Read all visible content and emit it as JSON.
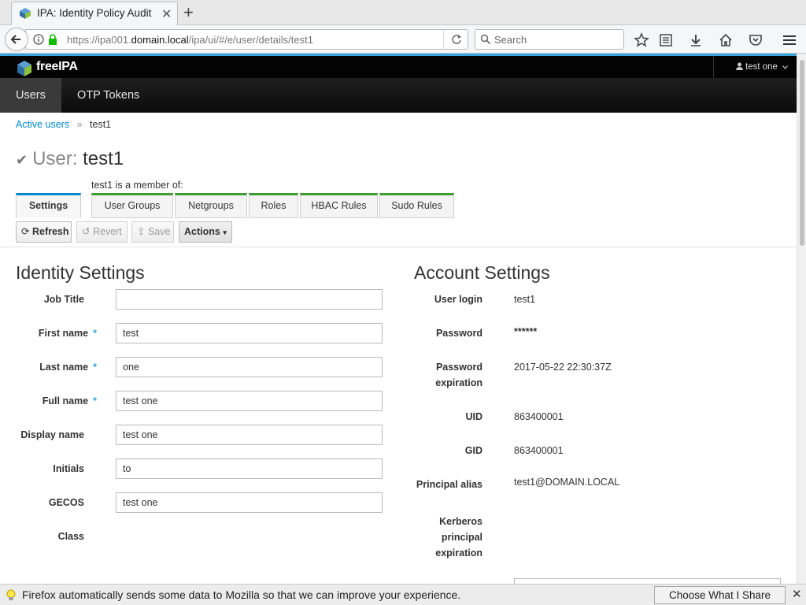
{
  "browser": {
    "tab_title": "IPA: Identity Policy Audit",
    "url_prefix": "https://ipa001.",
    "url_domain": "domain.local",
    "url_path": "/ipa/ui/#/e/user/details/test1",
    "search_placeholder": "Search"
  },
  "header": {
    "brand": "freeIPA",
    "user": "test one"
  },
  "nav": {
    "users": "Users",
    "otp": "OTP Tokens"
  },
  "breadcrumb": {
    "parent": "Active users",
    "separator": "»",
    "current": "test1"
  },
  "page": {
    "title_label": "User:",
    "title_name": "test1",
    "member_of": "test1 is a member of:"
  },
  "tabs": {
    "settings": "Settings",
    "user_groups": "User Groups",
    "netgroups": "Netgroups",
    "roles": "Roles",
    "hbac": "HBAC Rules",
    "sudo": "Sudo Rules"
  },
  "actions": {
    "refresh": "Refresh",
    "revert": "Revert",
    "save": "Save",
    "actions": "Actions"
  },
  "identity": {
    "title": "Identity Settings",
    "job_title": {
      "label": "Job Title",
      "value": ""
    },
    "first_name": {
      "label": "First name",
      "value": "test"
    },
    "last_name": {
      "label": "Last name",
      "value": "one"
    },
    "full_name": {
      "label": "Full name",
      "value": "test one"
    },
    "display_name": {
      "label": "Display name",
      "value": "test one"
    },
    "initials": {
      "label": "Initials",
      "value": "to"
    },
    "gecos": {
      "label": "GECOS",
      "value": "test one"
    },
    "class": {
      "label": "Class",
      "value": ""
    }
  },
  "account": {
    "title": "Account Settings",
    "user_login": {
      "label": "User login",
      "value": "test1"
    },
    "password": {
      "label": "Password",
      "value": "******"
    },
    "password_expiration": {
      "label1": "Password",
      "label2": "expiration",
      "value": "2017-05-22 22:30:37Z"
    },
    "uid": {
      "label": "UID",
      "value": "863400001"
    },
    "gid": {
      "label": "GID",
      "value": "863400001"
    },
    "principal_alias": {
      "label": "Principal alias",
      "value": "test1@DOMAIN.LOCAL"
    },
    "kerberos_expiration": {
      "label1": "Kerberos",
      "label2": "principal",
      "label3": "expiration",
      "value": ""
    }
  },
  "notification": {
    "text": "Firefox automatically sends some data to Mozilla so that we can improve your experience.",
    "button": "Choose What I Share"
  },
  "colors": {
    "accent_blue": "#0088ce",
    "tab_green": "#3f9c35",
    "header_bar": "#39a5dc"
  }
}
